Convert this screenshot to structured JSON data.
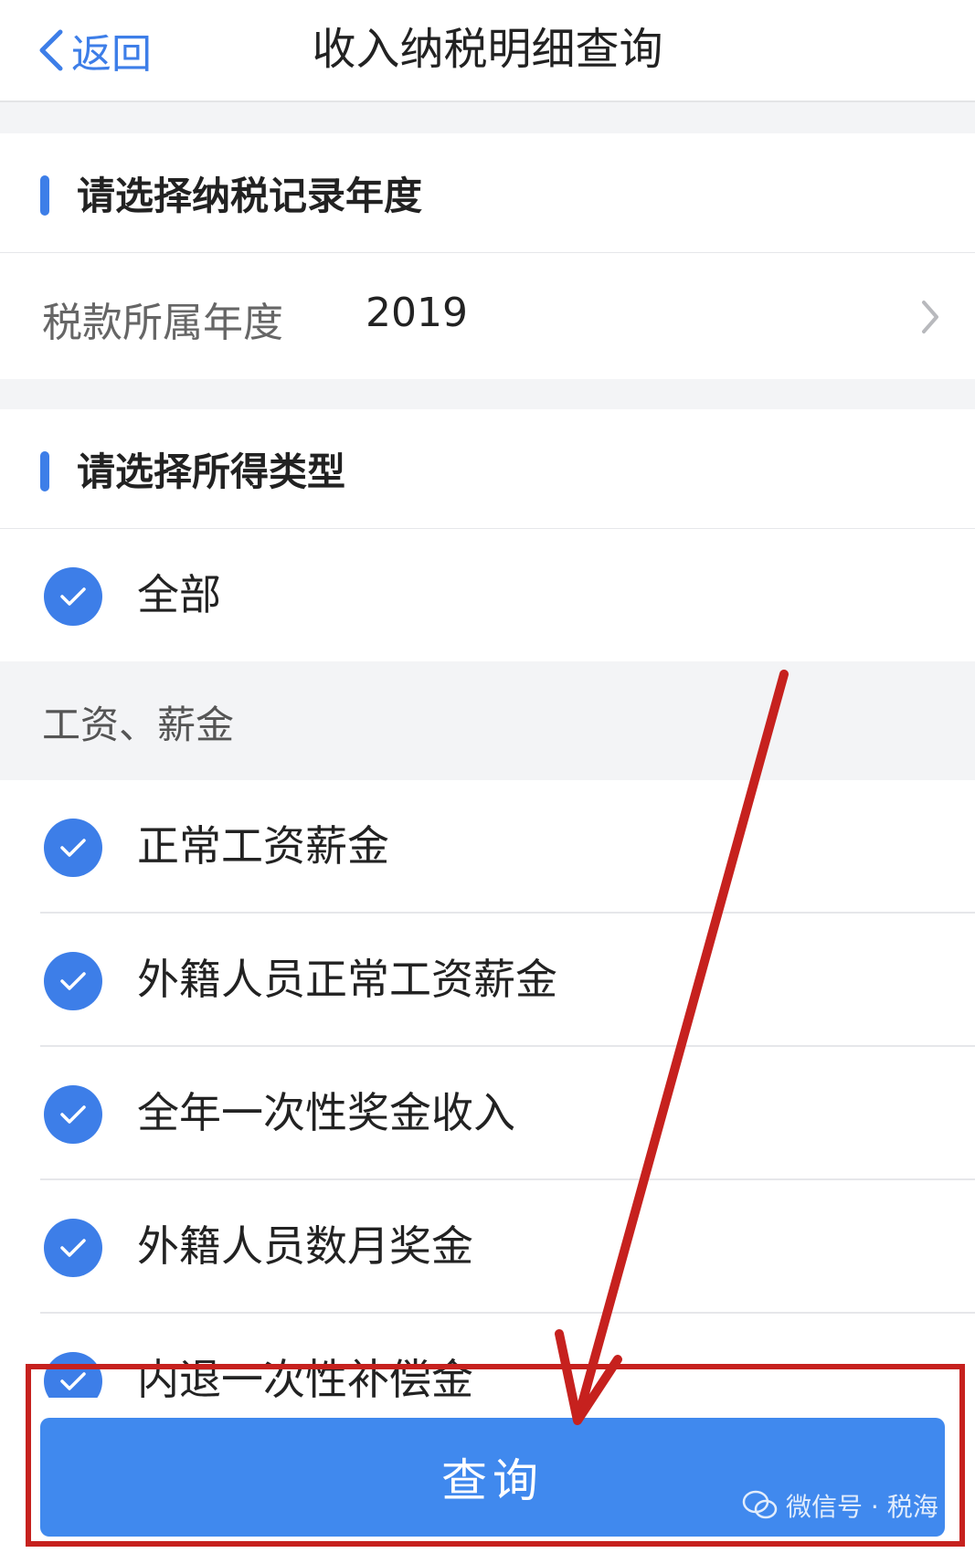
{
  "header": {
    "back_label": "返回",
    "title": "收入纳税明细查询"
  },
  "year_section": {
    "heading": "请选择纳税记录年度",
    "field_label": "税款所属年度",
    "field_value": "2019"
  },
  "type_section": {
    "heading": "请选择所得类型",
    "all_label": "全部",
    "group_label": "工资、薪金",
    "items": [
      {
        "label": "正常工资薪金",
        "checked": true
      },
      {
        "label": "外籍人员正常工资薪金",
        "checked": true
      },
      {
        "label": "全年一次性奖金收入",
        "checked": true
      },
      {
        "label": "外籍人员数月奖金",
        "checked": true
      },
      {
        "label": "内退一次性补偿金",
        "checked": true
      }
    ]
  },
  "footer": {
    "query_label": "查询",
    "watermark": "微信号 · 税海"
  },
  "colors": {
    "accent": "#3d7ee8",
    "button": "#4089ee",
    "annotation": "#c6211e"
  }
}
